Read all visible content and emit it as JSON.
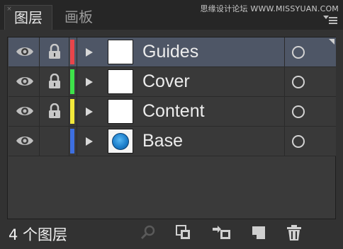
{
  "tabs": [
    {
      "label": "图层",
      "active": true
    },
    {
      "label": "画板",
      "active": false
    }
  ],
  "tab_close_glyph": "×",
  "watermark": "思缘设计论坛 WWW.MISSYUAN.COM",
  "panel_menu_icon": "panel-menu-icon",
  "layers": [
    {
      "name": "Guides",
      "visible": true,
      "locked": true,
      "color": "#e8454a",
      "thumbnail": "blank",
      "selected": true
    },
    {
      "name": "Cover",
      "visible": true,
      "locked": true,
      "color": "#3ee24a",
      "thumbnail": "blank",
      "selected": false
    },
    {
      "name": "Content",
      "visible": true,
      "locked": true,
      "color": "#f2e83a",
      "thumbnail": "blank",
      "selected": false
    },
    {
      "name": "Base",
      "visible": true,
      "locked": false,
      "color": "#3d6fe0",
      "thumbnail": "blue-circle",
      "selected": false
    }
  ],
  "footer": {
    "count_label": "4 个图层",
    "buttons": [
      "search-icon",
      "collect-for-export-icon",
      "make-clipping-mask-icon",
      "create-new-sublayer-icon",
      "create-new-layer-icon",
      "delete-layer-icon"
    ]
  },
  "colors": {
    "panel_bg": "#323232",
    "selected_row": "#4e5666",
    "text": "#ececec"
  }
}
